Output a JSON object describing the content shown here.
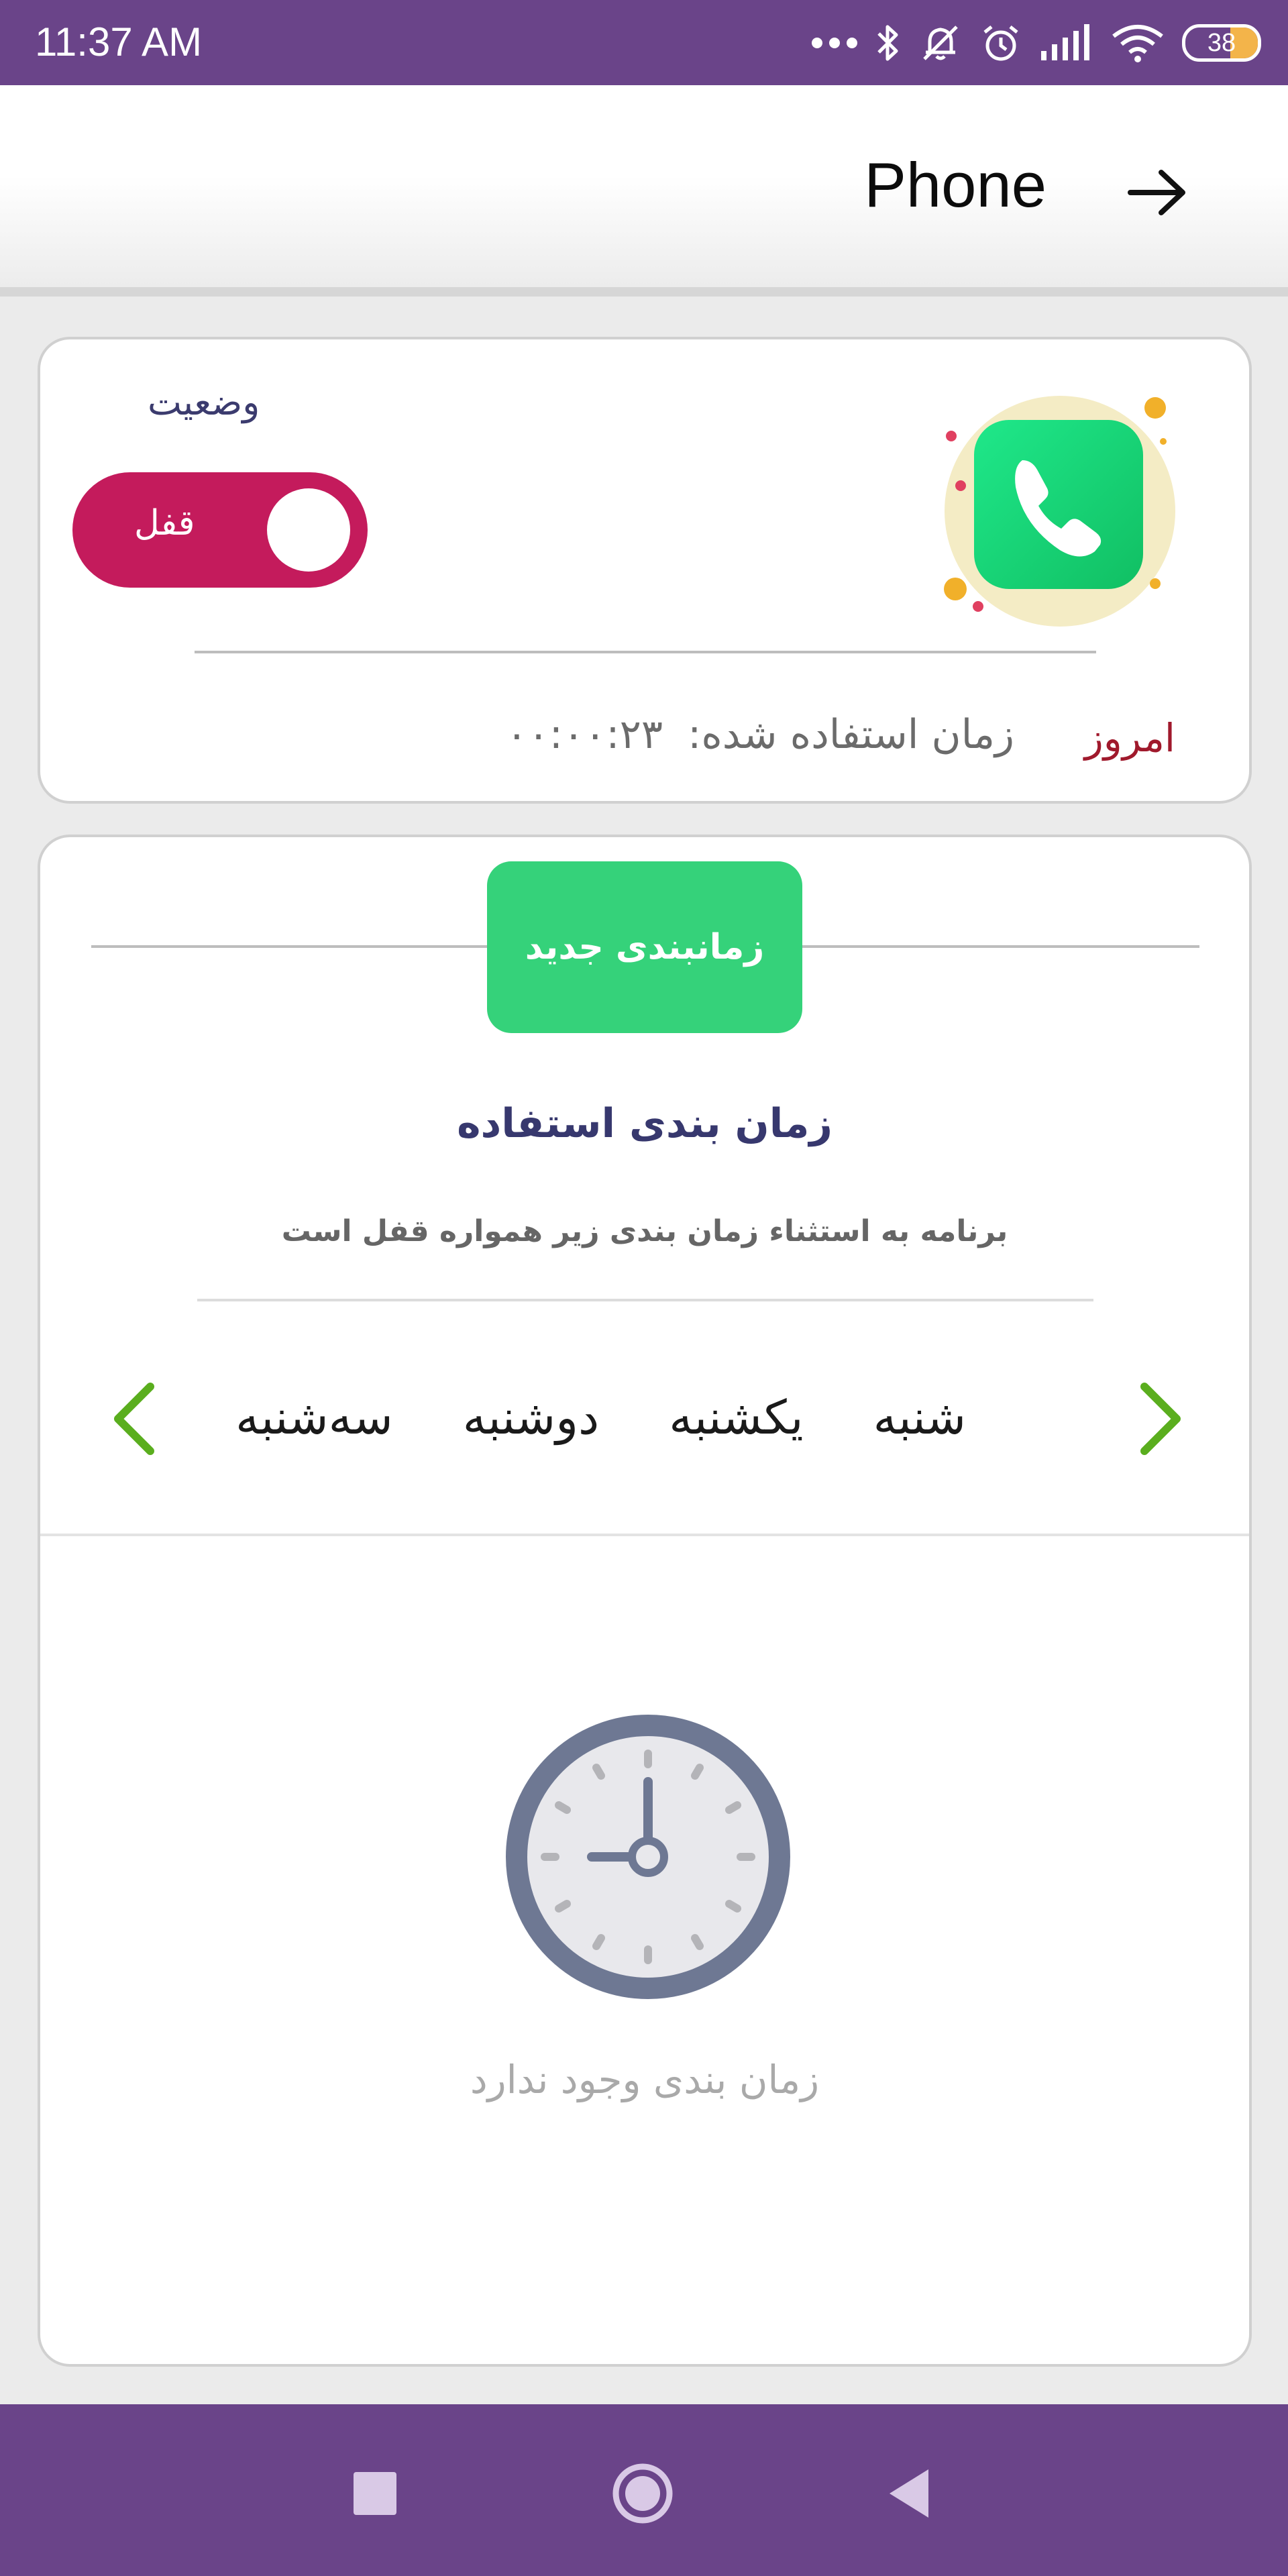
{
  "status_bar": {
    "time": "11:37 AM",
    "battery": "38",
    "battery_level": 0.38,
    "background_color": "#6a4489"
  },
  "header": {
    "title": "Phone",
    "back_icon": "arrow-right-icon"
  },
  "app_card": {
    "status_label": "وضعیت",
    "lock_toggle_label": "قفل",
    "lock_toggle_on": true,
    "lock_color": "#c41b5c",
    "app_icon": "phone-icon",
    "today_label": "امروز",
    "usage_label": "زمان استفاده شده:",
    "usage_value": "۰۰:۰۰:۲۳"
  },
  "schedule_card": {
    "new_schedule_button": "زمانبندی جدید",
    "title": "زمان بندی استفاده",
    "description": "برنامه به استثناء زمان بندی زیر همواره قفل است",
    "days": [
      "شنبه",
      "یکشنبه",
      "دوشنبه",
      "سه‌شنبه"
    ],
    "nav_icon_next": "chevron-right-icon",
    "nav_icon_prev": "chevron-left-icon",
    "accent_color": "#35d27a",
    "empty_icon": "clock-icon",
    "empty_label": "زمان بندی وجود ندارد"
  },
  "nav_bar": {
    "recents_icon": "square-icon",
    "home_icon": "circle-icon",
    "back_icon": "triangle-left-icon"
  }
}
